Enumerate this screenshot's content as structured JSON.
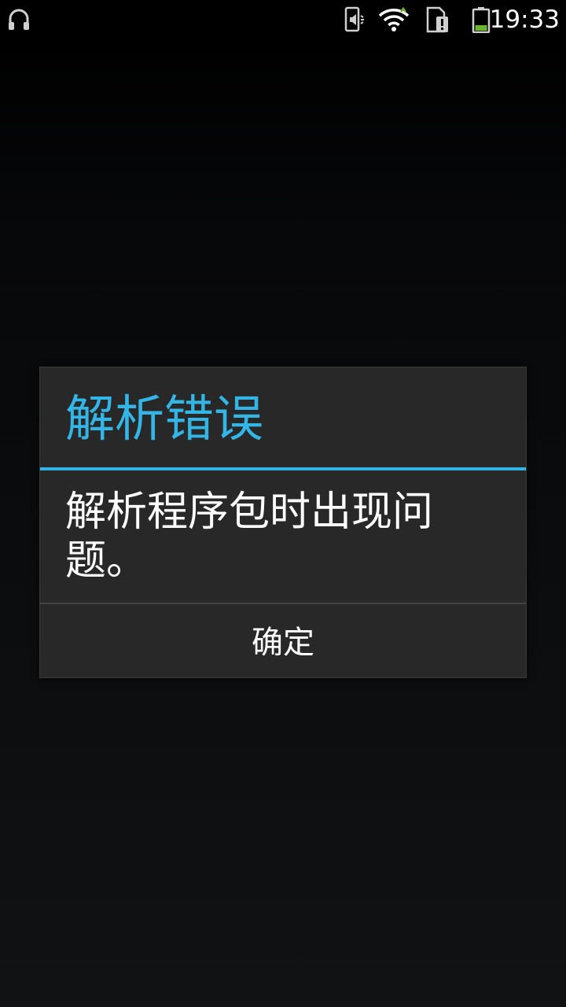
{
  "status_bar": {
    "time": "19:33",
    "icons": [
      "headphones-icon",
      "vibrate-mute-icon",
      "wifi-icon",
      "sim-alert-icon",
      "battery-icon"
    ],
    "battery_color": "#69b32e"
  },
  "dialog": {
    "title": "解析错误",
    "message": "解析程序包时出现问题。",
    "ok_label": "确定",
    "accent_color": "#33b5e5"
  }
}
